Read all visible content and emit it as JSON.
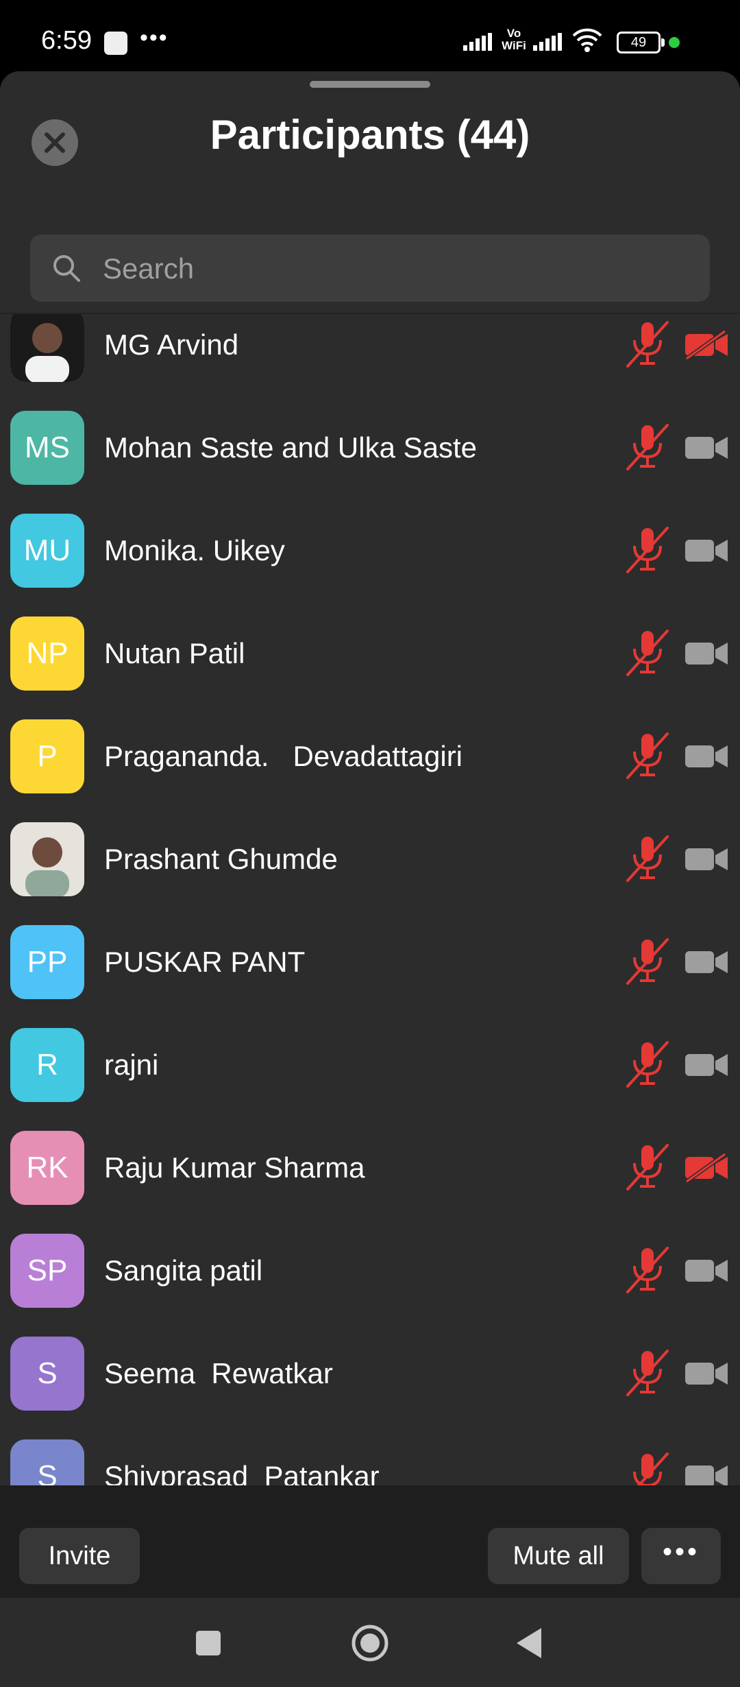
{
  "status_bar": {
    "time": "6:59",
    "vowifi_top": "Vo",
    "vowifi_bottom": "WiFi",
    "battery": "49"
  },
  "header": {
    "title": "Participants (44)"
  },
  "search": {
    "placeholder": "Search"
  },
  "participants": [
    {
      "name": "MG Arvind",
      "avatar_type": "photo",
      "muted": true,
      "video_off": true
    },
    {
      "name": "Mohan Saste and Ulka Saste",
      "initials": "MS",
      "avatar_color": "#4db6a4",
      "muted": true,
      "video_off": false
    },
    {
      "name": "Monika. Uikey",
      "initials": "MU",
      "avatar_color": "#42c8e0",
      "muted": true,
      "video_off": false
    },
    {
      "name": "Nutan Patil",
      "initials": "NP",
      "avatar_color": "#fdd835",
      "muted": true,
      "video_off": false
    },
    {
      "name": "Pragananda.   Devadattagiri",
      "initials": "P",
      "avatar_color": "#fdd835",
      "muted": true,
      "video_off": false
    },
    {
      "name": "Prashant Ghumde",
      "avatar_type": "photo",
      "muted": true,
      "video_off": false
    },
    {
      "name": "PUSKAR PANT",
      "initials": "PP",
      "avatar_color": "#4fc3f7",
      "muted": true,
      "video_off": false
    },
    {
      "name": "rajni",
      "initials": "R",
      "avatar_color": "#42c8e0",
      "muted": true,
      "video_off": false
    },
    {
      "name": "Raju Kumar Sharma",
      "initials": "RK",
      "avatar_color": "#e68fb5",
      "muted": true,
      "video_off": true
    },
    {
      "name": "Sangita patil",
      "initials": "SP",
      "avatar_color": "#b97fd6",
      "muted": true,
      "video_off": false
    },
    {
      "name": "Seema  Rewatkar",
      "initials": "S",
      "avatar_color": "#9575cd",
      "muted": true,
      "video_off": false
    },
    {
      "name": "Shivprasad  Patankar",
      "initials": "S",
      "avatar_color": "#7986cb",
      "muted": true,
      "video_off": false
    }
  ],
  "footer": {
    "invite_label": "Invite",
    "mute_all_label": "Mute all",
    "more_label": "..."
  },
  "colors": {
    "muted_red": "#e53935",
    "icon_gray": "#9e9e9e",
    "sheet_bg": "#2c2c2c"
  }
}
